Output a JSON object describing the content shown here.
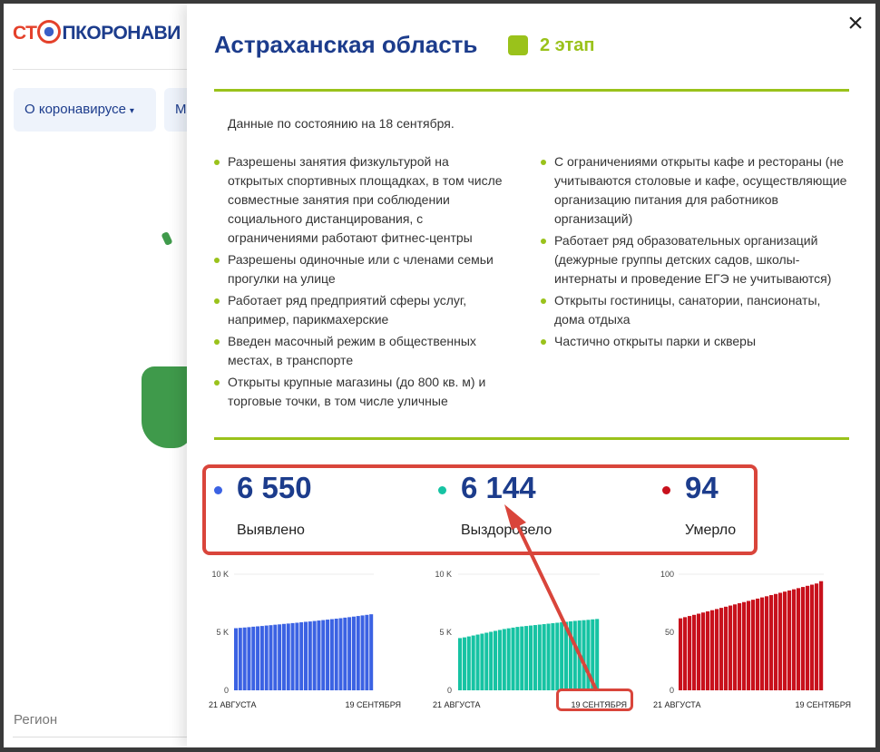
{
  "background": {
    "logo_prefix": "СТ",
    "logo_suffix": "ПКОРОНАВИ",
    "nav_items": [
      {
        "label": "О коронавирусе",
        "caret": "▾"
      },
      {
        "label": "М"
      }
    ],
    "region_label": "Регион"
  },
  "modal": {
    "title": "Астраханская область",
    "stage_label": "2 этап",
    "as_of": "Данные по состоянию на 18 сентября.",
    "left_items": [
      "Разрешены занятия физкультурой на открытых спортивных площадках, в том числе совместные занятия при соблюдении социального дистанцирования, с ограничениями работают фитнес-центры",
      "Разрешены одиночные или с членами семьи прогулки на улице",
      "Работает ряд предприятий сферы услуг, например, парикмахерские",
      "Введен масочный режим в общественных местах, в транспорте",
      "Открыты крупные магазины (до 800 кв. м) и торговые точки, в том числе уличные"
    ],
    "right_items": [
      "С ограничениями открыты кафе и рестораны (не учитываются столовые и кафе, осуществляющие организацию питания для работников организаций)",
      "Работает ряд образовательных организаций (дежурные группы детских садов, школы-интернаты и проведение ЕГЭ не учитываются)",
      "Открыты гостиницы, санатории, пансионаты, дома отдыха",
      "Частично открыты парки и скверы"
    ],
    "close_icon": "×"
  },
  "stats": [
    {
      "value": "6 550",
      "label": "Выявлено",
      "color": "#3b62e3"
    },
    {
      "value": "6 144",
      "label": "Выздоровело",
      "color": "#16c3a3"
    },
    {
      "value": "94",
      "label": "Умерло",
      "color": "#c8111c"
    }
  ],
  "colors": {
    "accent_green": "#9ac21b",
    "title_blue": "#1c3c8c",
    "highlight_red": "#d9453b"
  },
  "chart_data": [
    {
      "type": "bar",
      "series_color": "#3b62e3",
      "y_ticks": [
        "10 K",
        "5 K",
        "0"
      ],
      "ylim": [
        0,
        10000
      ],
      "x_start_label": "21 АВГУСТА",
      "x_end_label": "19 СЕНТЯБРЯ",
      "values": [
        5350,
        5380,
        5410,
        5440,
        5480,
        5510,
        5540,
        5580,
        5610,
        5650,
        5680,
        5720,
        5750,
        5790,
        5820,
        5860,
        5900,
        5930,
        5970,
        6010,
        6050,
        6090,
        6130,
        6170,
        6210,
        6260,
        6300,
        6350,
        6400,
        6450,
        6500,
        6550
      ]
    },
    {
      "type": "bar",
      "series_color": "#16c3a3",
      "y_ticks": [
        "10 K",
        "5 K",
        "0"
      ],
      "ylim": [
        0,
        10000
      ],
      "x_start_label": "21 АВГУСТА",
      "x_end_label": "19 СЕНТЯБРЯ",
      "values": [
        4500,
        4560,
        4640,
        4720,
        4800,
        4880,
        4960,
        5040,
        5120,
        5200,
        5280,
        5340,
        5400,
        5460,
        5500,
        5540,
        5580,
        5620,
        5660,
        5700,
        5740,
        5780,
        5820,
        5860,
        5900,
        5940,
        5980,
        6010,
        6040,
        6070,
        6110,
        6144
      ]
    },
    {
      "type": "bar",
      "series_color": "#c8111c",
      "y_ticks": [
        "100",
        "50",
        "0"
      ],
      "ylim": [
        0,
        100
      ],
      "x_start_label": "21 АВГУСТА",
      "x_end_label": "19 СЕНТЯБРЯ",
      "values": [
        62,
        63,
        64,
        65,
        66,
        67,
        68,
        69,
        70,
        71,
        72,
        73,
        74,
        75,
        76,
        77,
        78,
        79,
        80,
        81,
        82,
        83,
        84,
        85,
        86,
        87,
        88,
        89,
        90,
        91,
        92,
        94
      ]
    }
  ]
}
